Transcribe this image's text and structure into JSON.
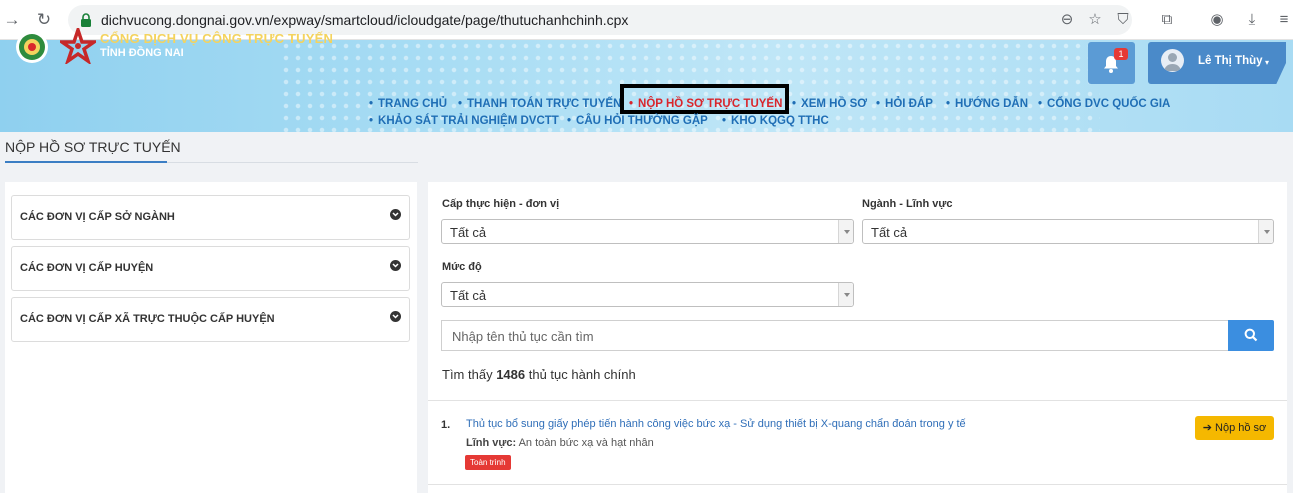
{
  "browser": {
    "url": "dichvucong.dongnai.gov.vn/expway/smartcloud/icloudgate/page/thutuchanhchinh.cpx"
  },
  "header": {
    "portal_title": "CỔNG DỊCH VỤ CÔNG TRỰC TUYẾN",
    "portal_subtitle": "TỈNH ĐỒNG NAI",
    "notification_count": "1",
    "user_name": "Lê Thị Thùy",
    "menu": [
      {
        "label": "Trang chủ"
      },
      {
        "label": "Thanh toán trực tuyến"
      },
      {
        "label": "Nộp hồ sơ trực tuyến",
        "active": true
      },
      {
        "label": "Xem hồ sơ"
      },
      {
        "label": "Hỏi đáp"
      },
      {
        "label": "Hướng dẫn"
      },
      {
        "label": "Cổng DVC Quốc gia"
      },
      {
        "label": "Khảo sát trải nghiệm DVCTT"
      },
      {
        "label": "Câu hỏi thường gặp"
      },
      {
        "label": "Kho KQGQ TTHC"
      }
    ]
  },
  "page": {
    "title": "NỘP HỒ SƠ TRỰC TUYẾN"
  },
  "sidebar": {
    "items": [
      {
        "label": "CÁC ĐƠN VỊ CẤP SỞ NGÀNH"
      },
      {
        "label": "CÁC ĐƠN VỊ CẤP HUYỆN"
      },
      {
        "label": "CÁC ĐƠN VỊ CẤP XÃ TRỰC THUỘC CẤP HUYỆN"
      }
    ]
  },
  "filters": {
    "level_label": "Cấp thực hiện - đơn vị",
    "level_value": "Tất cả",
    "sector_label": "Ngành - Lĩnh vực",
    "sector_value": "Tất cả",
    "degree_label": "Mức độ",
    "degree_value": "Tất cả",
    "search_placeholder": "Nhập tên thủ tục cần tìm"
  },
  "results": {
    "prefix": "Tìm thấy",
    "count": "1486",
    "suffix": "thủ tục hành chính",
    "items": [
      {
        "number": "1.",
        "title": "Thủ tục bổ sung giấy phép tiến hành công việc bức xạ - Sử dụng thiết bị X-quang chẩn đoán trong y tế",
        "field_label": "Lĩnh vực:",
        "field_value": "An toàn bức xạ và hạt nhân",
        "badge": "Toàn trình",
        "submit_label": "➔ Nộp hồ sơ"
      }
    ]
  },
  "colors": {
    "menu_blue": "#1f6eb5",
    "menu_active": "#d9262c",
    "submit_yellow": "#f5b800",
    "search_blue": "#3b8ee0",
    "badge_red": "#e53935"
  }
}
